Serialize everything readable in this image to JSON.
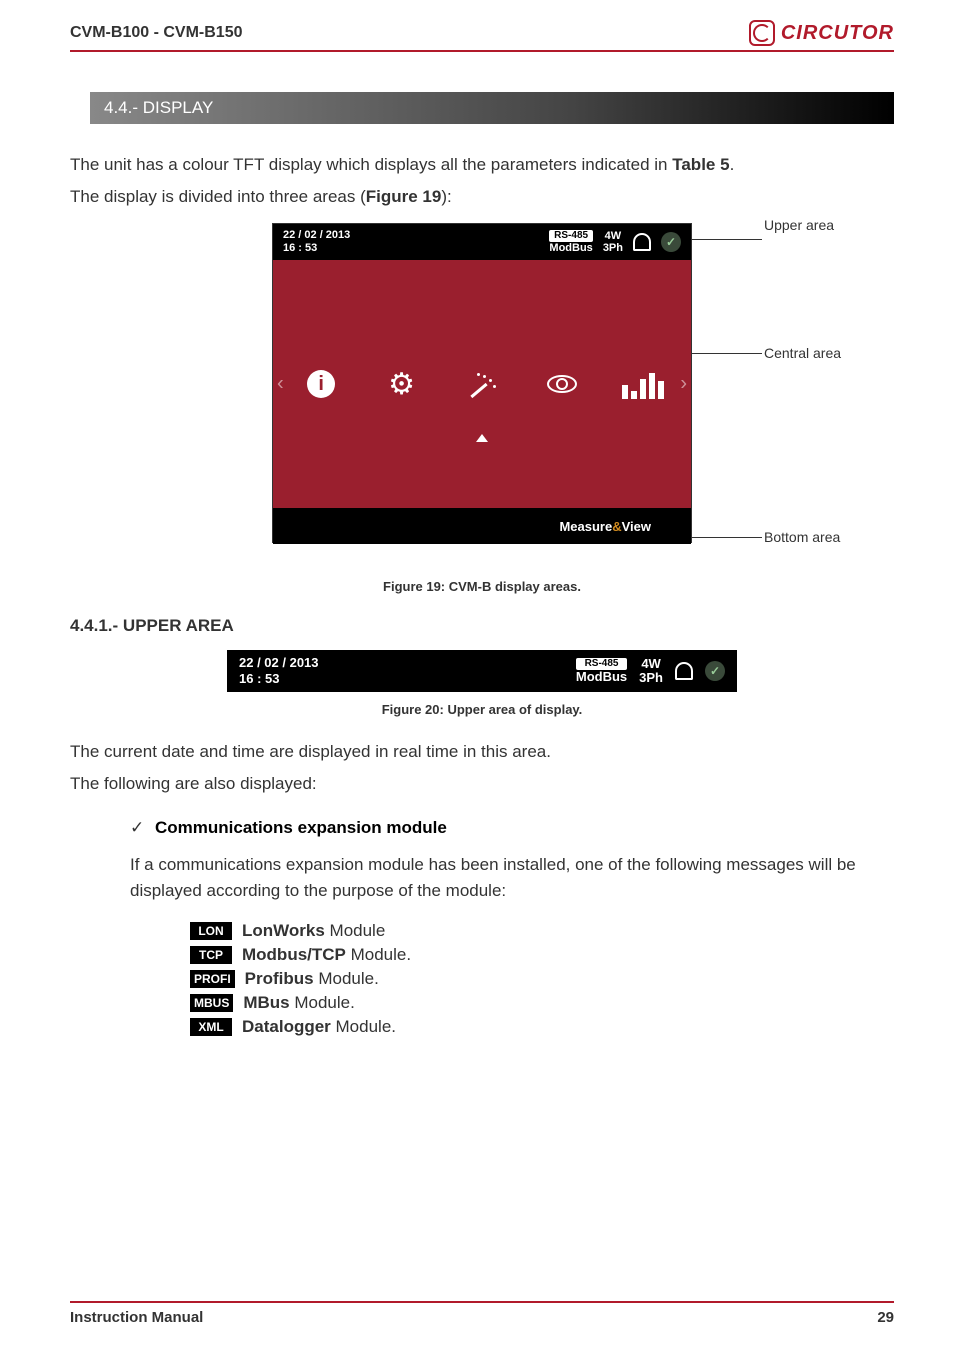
{
  "header": {
    "title": "CVM-B100 - CVM-B150",
    "brand": "CIRCUTOR"
  },
  "section": {
    "title": "4.4.- DISPLAY"
  },
  "intro": {
    "line1_a": "The unit has a colour TFT display which displays all the parameters indicated in ",
    "line1_b": "Table 5",
    "line1_c": ".",
    "line2_a": "The display is divided into three areas (",
    "line2_b": "Figure 19",
    "line2_c": "):"
  },
  "figure19": {
    "callout_upper": "Upper area",
    "callout_central": "Central area",
    "callout_bottom": "Bottom area",
    "date": "22 / 02 / 2013",
    "time": "16 : 53",
    "rs485": "RS-485",
    "modbus": "ModBus",
    "w4": "4W",
    "ph3": "3Ph",
    "bottom_a": "Measure ",
    "bottom_amp": "&",
    "bottom_b": " View",
    "caption": "Figure 19: CVM-B display areas."
  },
  "subsection": {
    "title": "4.4.1.- UPPER AREA"
  },
  "figure20": {
    "date": "22 / 02 / 2013",
    "time": "16 : 53",
    "rs485": "RS-485",
    "modbus": "ModBus",
    "w4": "4W",
    "ph3": "3Ph",
    "caption": "Figure 20: Upper area of display."
  },
  "upper_desc": {
    "line1": "The current date and time are displayed in real time in this area.",
    "line2": "The following are also displayed:"
  },
  "comm": {
    "checkmark": "✓",
    "title": "Communications expansion module",
    "desc": "If a communications expansion module has been installed, one of the following messages will be displayed according to the purpose of the module:"
  },
  "modules": [
    {
      "tag": "LON",
      "bold": "LonWorks",
      "rest": " Module"
    },
    {
      "tag": "TCP",
      "bold": "Modbus/TCP",
      "rest": " Module."
    },
    {
      "tag": "PROFI",
      "bold": "Profibus",
      "rest": " Module."
    },
    {
      "tag": "MBUS",
      "bold": "MBus",
      "rest": " Module."
    },
    {
      "tag": "XML",
      "bold": "Datalogger",
      "rest": " Module."
    }
  ],
  "footer": {
    "left": "Instruction Manual",
    "right": "29"
  }
}
